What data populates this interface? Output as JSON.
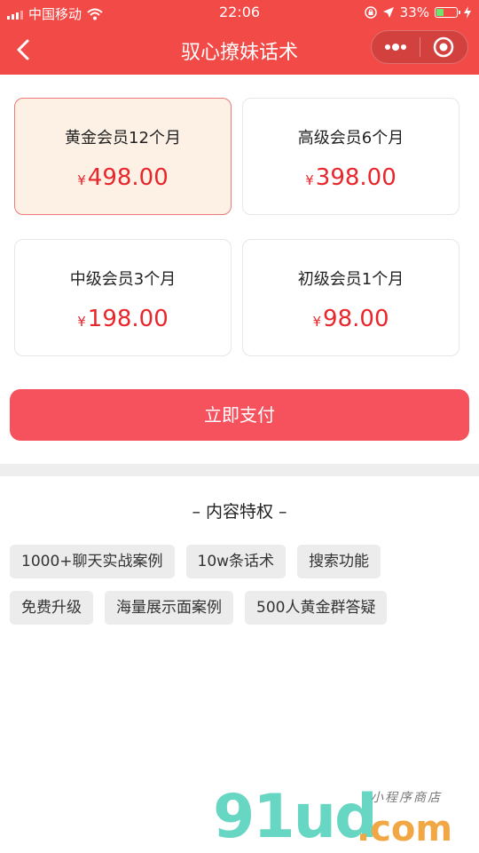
{
  "status_bar": {
    "carrier": "中国移动",
    "time": "22:06",
    "battery": "33%"
  },
  "nav": {
    "title": "驭心撩妹话术"
  },
  "plans": [
    {
      "name": "黄金会员12个月",
      "currency": "¥",
      "price": "498.00",
      "selected": true
    },
    {
      "name": "高级会员6个月",
      "currency": "¥",
      "price": "398.00",
      "selected": false
    },
    {
      "name": "中级会员3个月",
      "currency": "¥",
      "price": "198.00",
      "selected": false
    },
    {
      "name": "初级会员1个月",
      "currency": "¥",
      "price": "98.00",
      "selected": false
    }
  ],
  "pay_button": {
    "label": "立即支付"
  },
  "privileges": {
    "title": "– 内容特权 –",
    "tags": [
      "1000+聊天实战案例",
      "10w条话术",
      "搜索功能",
      "免费升级",
      "海量展示面案例",
      "500人黄金群答疑"
    ]
  },
  "watermark": {
    "logo": "91ud",
    "suffix": ".com",
    "subtitle": "小程序商店"
  },
  "colors": {
    "header": "#f14a47",
    "pay_button": "#f5525e",
    "price": "#e8262b",
    "selected_card_bg": "#fdf1e6",
    "selected_card_border": "#f07979"
  },
  "icons": {
    "back": "chevron-left-icon",
    "more": "more-dots-icon",
    "close": "target-circle-icon",
    "signal": "signal-icon",
    "wifi": "wifi-icon",
    "location": "location-arrow-icon",
    "lock": "rotation-lock-icon",
    "battery": "battery-icon"
  }
}
